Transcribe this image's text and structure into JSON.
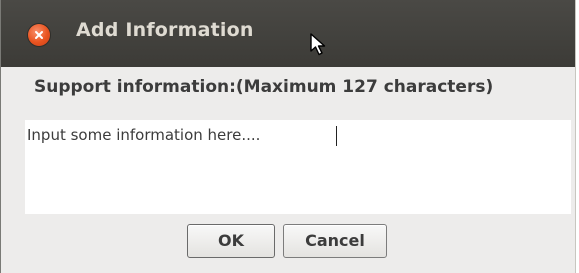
{
  "window": {
    "title": "Add Information",
    "close_icon": "close-icon"
  },
  "form": {
    "label": "Support information:(Maximum 127 characters)",
    "input_value": "Input some information here...."
  },
  "buttons": {
    "ok_label": "OK",
    "cancel_label": "Cancel"
  },
  "colors": {
    "titlebar": "#3c3b37",
    "close_button": "#e9531f",
    "dialog_background": "#edeceb"
  }
}
